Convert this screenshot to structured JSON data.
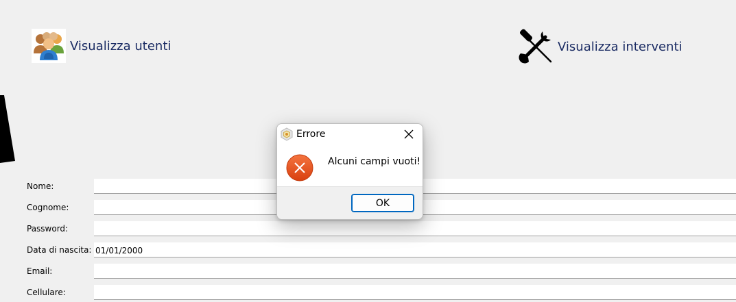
{
  "nav": {
    "users_label": "Visualizza utenti",
    "interventi_label": "Visualizza interventi",
    "users_icon": "users-group-icon",
    "interventi_icon": "wrench-screwdriver-icon"
  },
  "form": {
    "fields": [
      {
        "label": "Nome:",
        "value": ""
      },
      {
        "label": "Cognome:",
        "value": ""
      },
      {
        "label": "Password:",
        "value": ""
      },
      {
        "label": "Data di nascita:",
        "value": "01/01/2000"
      },
      {
        "label": "Email:",
        "value": ""
      },
      {
        "label": "Cellulare:",
        "value": ""
      }
    ]
  },
  "dialog": {
    "title": "Errore",
    "message": "Alcuni campi vuoti!",
    "ok_label": "OK",
    "icon": "error-icon",
    "close_icon": "close-icon",
    "colors": {
      "error": "#e8501e",
      "accent": "#0067c0"
    }
  }
}
